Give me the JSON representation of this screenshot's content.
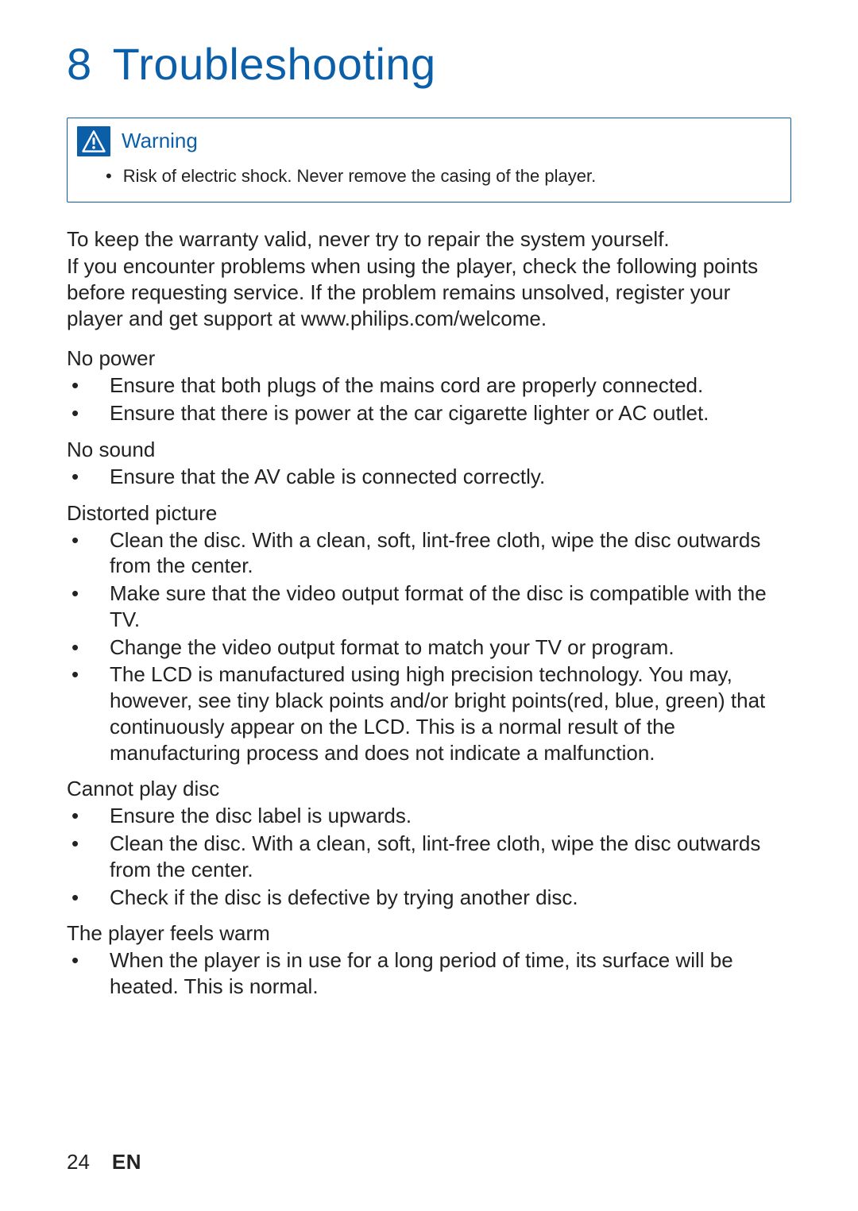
{
  "chapter": {
    "number": "8",
    "title": "Troubleshooting"
  },
  "warning": {
    "label": "Warning",
    "bullet": "Risk of electric shock. Never remove the casing of the player."
  },
  "intro_lines": [
    "To keep the warranty valid, never try to repair the system yourself.",
    "If you encounter problems when using the player, check the following points before requesting service. If the problem remains unsolved, register your player and get support at www.philips.com/welcome."
  ],
  "sections": [
    {
      "title": "No power",
      "items": [
        "Ensure that both plugs of the mains cord are properly connected.",
        "Ensure that there is power at the car cigarette lighter or AC outlet."
      ]
    },
    {
      "title": "No sound",
      "items": [
        "Ensure that the AV cable is connected correctly."
      ]
    },
    {
      "title": "Distorted picture",
      "items": [
        "Clean the disc. With a clean, soft, lint-free cloth, wipe the disc outwards from the center.",
        "Make sure that the video output format of the disc is compatible with the TV.",
        "Change the video output format to match your TV or program.",
        "The LCD is manufactured using high precision technology.  You may, however, see tiny black points and/or bright points(red, blue, green) that continuously appear on the LCD. This is a normal result of the manufacturing process and does not indicate a malfunction."
      ]
    },
    {
      "title": "Cannot play disc",
      "items": [
        "Ensure the disc label is upwards.",
        "Clean the disc. With a clean, soft, lint-free cloth, wipe the disc outwards from the center.",
        "Check if the disc is defective by trying another disc."
      ]
    },
    {
      "title": "The player feels warm",
      "items": [
        "When the player is in use for a long period of time, its surface will be heated. This is normal."
      ]
    }
  ],
  "footer": {
    "page": "24",
    "lang": "EN"
  }
}
